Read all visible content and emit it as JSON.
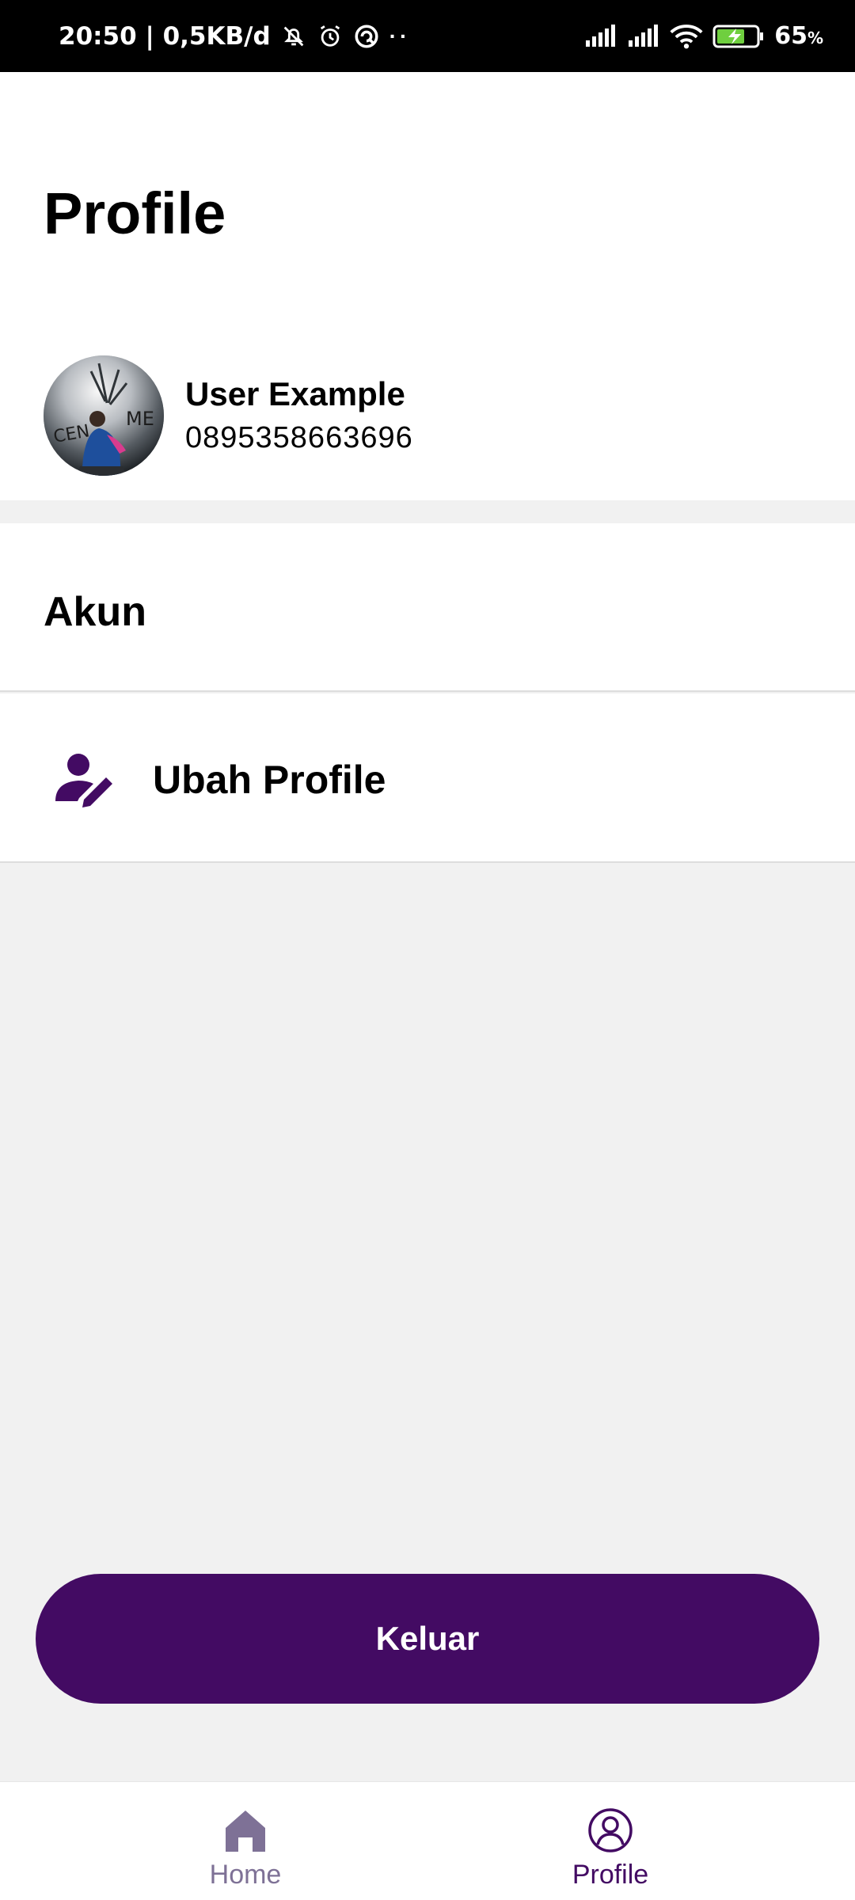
{
  "status_bar": {
    "time_data": "20:50 | 0,5KB/d",
    "dots": "··",
    "battery": "65",
    "battery_unit": "%",
    "icons": [
      "mute-icon",
      "alarm-icon",
      "sync-icon",
      "signal-icon",
      "signal-icon",
      "wifi-icon",
      "battery-charging-icon"
    ]
  },
  "header": {
    "title": "Profile"
  },
  "user": {
    "name": "User Example",
    "phone": "0895358663696"
  },
  "account": {
    "section_title": "Akun",
    "items": [
      {
        "label": "Ubah Profile",
        "icon": "edit-user-icon"
      }
    ]
  },
  "actions": {
    "logout_label": "Keluar"
  },
  "bottom_nav": {
    "items": [
      {
        "label": "Home",
        "icon": "home-icon",
        "active": false
      },
      {
        "label": "Profile",
        "icon": "profile-icon",
        "active": true
      }
    ]
  },
  "colors": {
    "primary": "#430b63",
    "inactive_nav": "#7e7196",
    "background": "#f1f1f1"
  }
}
